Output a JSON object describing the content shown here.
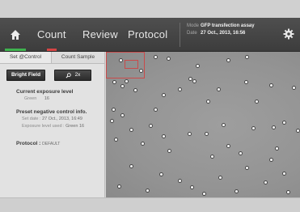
{
  "nav": {
    "tabs": [
      "Count",
      "Review",
      "Protocol"
    ],
    "mode_label": "Mode",
    "mode_value": "GFP transfection assay",
    "date_label": "Date",
    "date_value": "27 Oct., 2013, 16:56"
  },
  "left_panel": {
    "tabs": [
      "Set @Control",
      "Count Sample"
    ],
    "bright_field_label": "Bright Field",
    "zoom_label": "2x",
    "exposure_heading": "Current exposure level",
    "exposure_channel": "Green",
    "exposure_value": "16",
    "preset_heading": "Preset negative control info.",
    "set_date_label": "Set date :",
    "set_date_value": "27 Oct., 2013, 16:49",
    "exposure_used_label": "Exposure level used :",
    "exposure_used_value": "Green 16",
    "protocol_label": "Protocol :",
    "protocol_value": "DEFAULT"
  }
}
